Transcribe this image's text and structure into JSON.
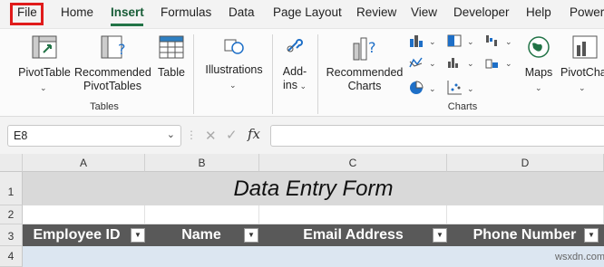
{
  "menu": {
    "tabs": [
      "File",
      "Home",
      "Insert",
      "Formulas",
      "Data",
      "Page Layout",
      "Review",
      "View",
      "Developer",
      "Help",
      "Power"
    ],
    "active": "Insert"
  },
  "ribbon": {
    "pivottable": "PivotTable",
    "recommended_pivottables_1": "Recommended",
    "recommended_pivottables_2": "PivotTables",
    "table": "Table",
    "illustrations": "Illustrations",
    "addins_1": "Add-",
    "addins_2": "ins",
    "recommended_charts_1": "Recommended",
    "recommended_charts_2": "Charts",
    "maps": "Maps",
    "pivotchart": "PivotCha",
    "group_tables": "Tables",
    "group_charts": "Charts"
  },
  "formula_bar": {
    "name_box": "E8",
    "fx": "fx",
    "formula": ""
  },
  "sheet": {
    "columns": [
      "A",
      "B",
      "C",
      "D"
    ],
    "rows": [
      "1",
      "2",
      "3",
      "4"
    ],
    "title": "Data Entry Form",
    "headers": [
      "Employee ID",
      "Name",
      "Email Address",
      "Phone Number"
    ]
  },
  "colors": {
    "accent": "#217346",
    "header_bg": "#595959",
    "title_bg": "#d9d9d9",
    "row_band": "#dce6f1",
    "highlight": "#e01b1b"
  },
  "watermark": "wsxdn.com"
}
